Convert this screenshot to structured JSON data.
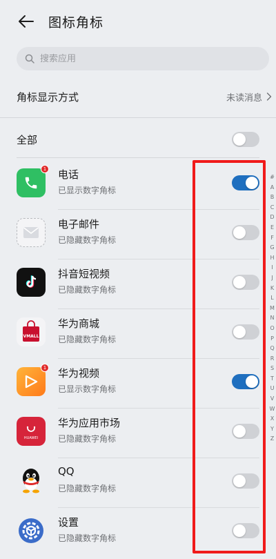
{
  "header": {
    "title": "图标角标"
  },
  "search": {
    "placeholder": "搜索应用"
  },
  "badge_display": {
    "label": "角标显示方式",
    "value": "未读消息"
  },
  "all_row": {
    "label": "全部",
    "toggle_on": false
  },
  "apps": [
    {
      "name": "电话",
      "status": "已显示数字角标",
      "toggle_on": true,
      "icon": "phone-icon",
      "badge": "1"
    },
    {
      "name": "电子邮件",
      "status": "已隐藏数字角标",
      "toggle_on": false,
      "icon": "email-icon"
    },
    {
      "name": "抖音短视频",
      "status": "已隐藏数字角标",
      "toggle_on": false,
      "icon": "tiktok-icon"
    },
    {
      "name": "华为商城",
      "status": "已隐藏数字角标",
      "toggle_on": false,
      "icon": "vmall-icon",
      "icon_text": "VMALL"
    },
    {
      "name": "华为视频",
      "status": "已显示数字角标",
      "toggle_on": true,
      "icon": "video-icon",
      "badge": "1"
    },
    {
      "name": "华为应用市场",
      "status": "已隐藏数字角标",
      "toggle_on": false,
      "icon": "appgallery-icon",
      "icon_text": "HUAWEI"
    },
    {
      "name": "QQ",
      "status": "已隐藏数字角标",
      "toggle_on": false,
      "icon": "qq-icon"
    },
    {
      "name": "设置",
      "status": "已隐藏数字角标",
      "toggle_on": false,
      "icon": "settings-icon"
    }
  ],
  "alphabet_index": [
    "#",
    "A",
    "B",
    "C",
    "D",
    "E",
    "F",
    "G",
    "H",
    "I",
    "J",
    "K",
    "L",
    "M",
    "N",
    "O",
    "P",
    "Q",
    "R",
    "S",
    "T",
    "U",
    "V",
    "W",
    "X",
    "Y",
    "Z"
  ],
  "colors": {
    "accent": "#1f6fbf",
    "highlight": "#f01a1a",
    "background": "#eceef1"
  }
}
